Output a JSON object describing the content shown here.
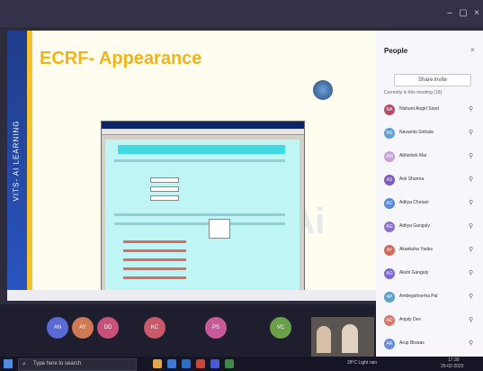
{
  "slide": {
    "title": "ECRF- Appearance",
    "strip_text": "VITS- AI LEARNING"
  },
  "people_panel": {
    "title": "People",
    "close_icon": "close-icon",
    "share_invite_label": "Share invite",
    "section_label": "Currently in this meeting (18)",
    "participants": [
      {
        "initials": "NA",
        "name": "Nishant Angiri Sood",
        "color": "#b64c6a"
      },
      {
        "initials": "NS",
        "name": "Navanita Sinhala",
        "color": "#5ea0d8"
      },
      {
        "initials": "AM",
        "name": "Abhishek Mai",
        "color": "#c8a0d8"
      },
      {
        "initials": "AS",
        "name": "Anil Sharma",
        "color": "#7b5ac4"
      },
      {
        "initials": "AC",
        "name": "Aditya Chotani",
        "color": "#5b8bd8"
      },
      {
        "initials": "AG",
        "name": "Aditya Ganguly",
        "color": "#8d71d1"
      },
      {
        "initials": "AY",
        "name": "Akanksha Yadav",
        "color": "#d26a5a"
      },
      {
        "initials": "AG",
        "name": "Akshi Ganguly",
        "color": "#7d6ad6"
      },
      {
        "initials": "AP",
        "name": "Ambegshnerha Pal",
        "color": "#5aa0c8"
      },
      {
        "initials": "AD",
        "name": "Anjaly Dev",
        "color": "#d8786a"
      },
      {
        "initials": "AR",
        "name": "Arup Biswas",
        "color": "#6a8ad8"
      }
    ]
  },
  "call_tiles": [
    {
      "initials": "AN",
      "color": "#5a6ad6"
    },
    {
      "initials": "AY",
      "color": "#d07a55"
    },
    {
      "initials": "DD",
      "color": "#c9507a"
    },
    {
      "initials": "KC",
      "color": "#c85a6a"
    },
    {
      "initials": "PS",
      "color": "#c85a9a"
    },
    {
      "initials": "VC",
      "color": "#6aa04a"
    }
  ],
  "taskbar": {
    "search_placeholder": "Type here to search",
    "tray": "28°C Light rain",
    "time": "17:30",
    "date": "25-02-2022"
  },
  "colors": {
    "slide_title": "#f0b419",
    "ecrf_header": "#41d9e6",
    "teams_bg": "#2d2c3c"
  }
}
